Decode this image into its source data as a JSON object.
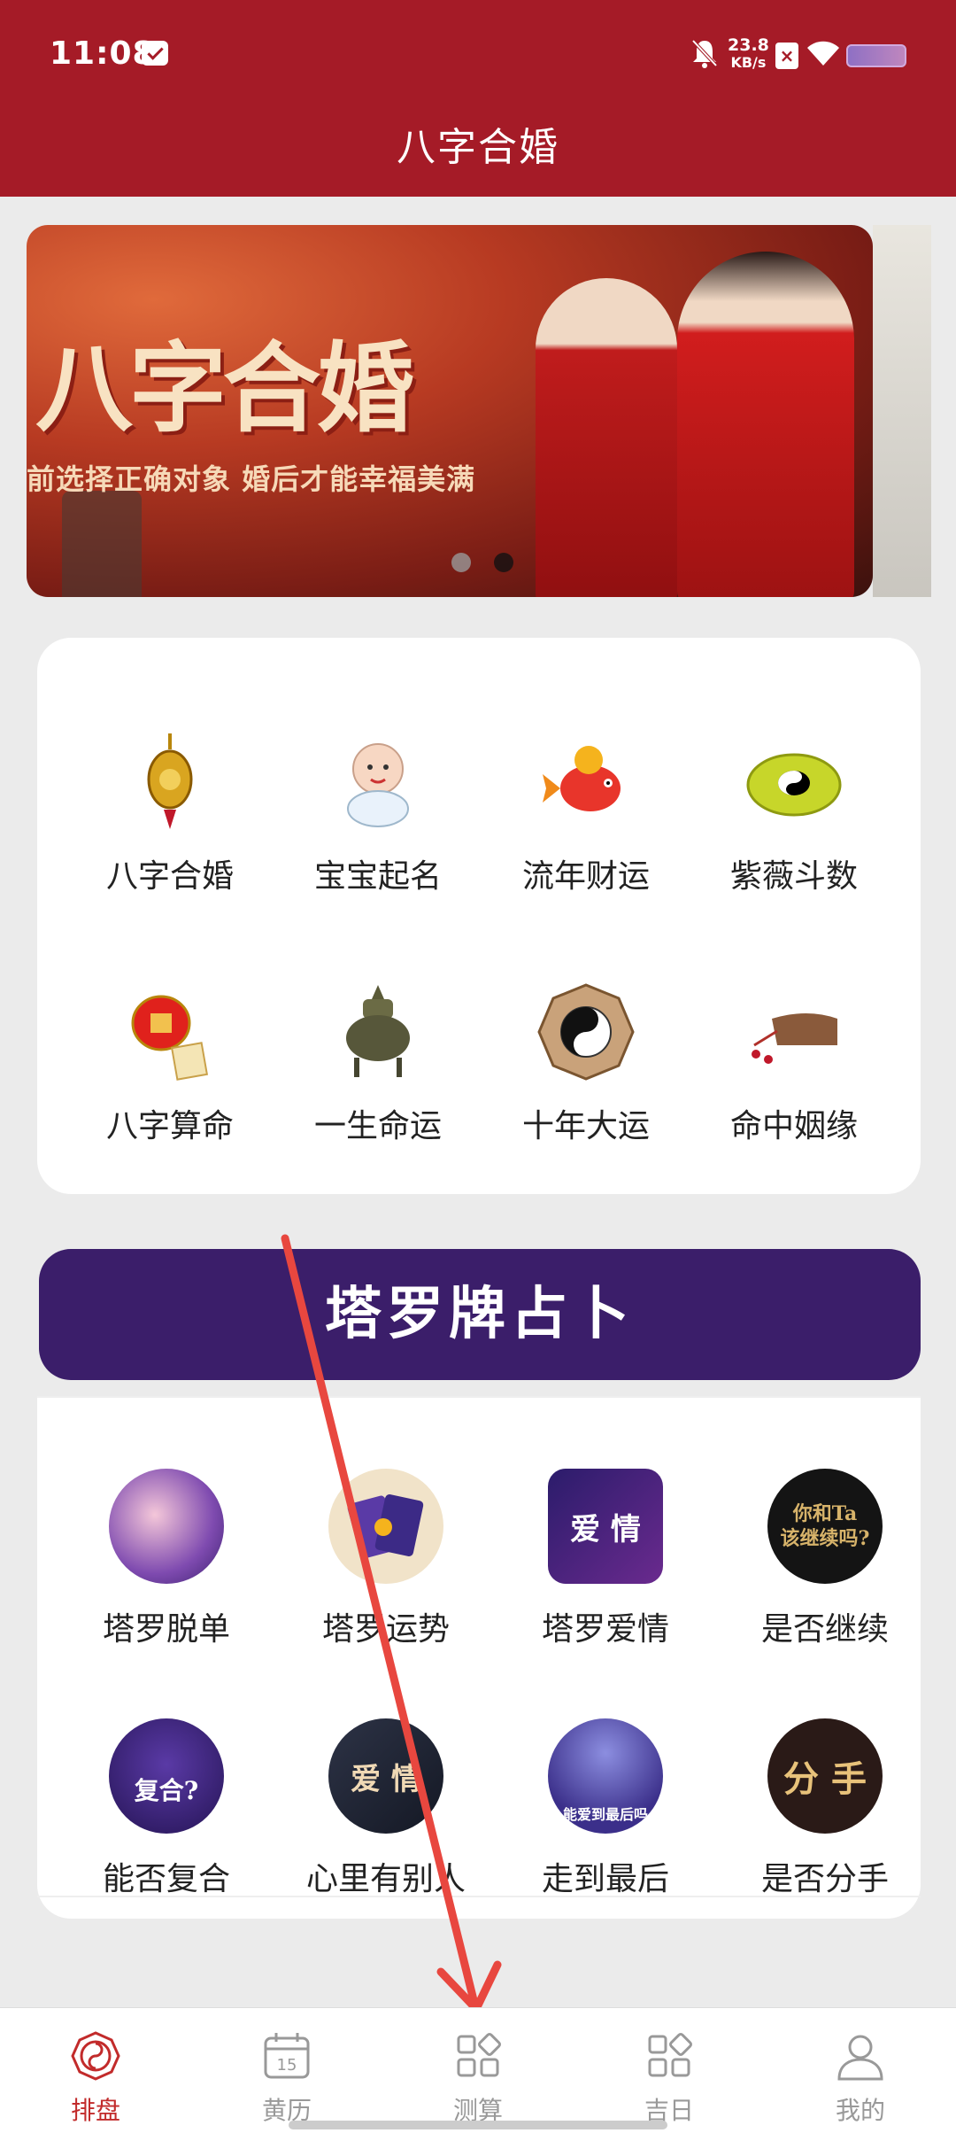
{
  "status_bar": {
    "time": "11:08",
    "net_speed_value": "23.8",
    "net_speed_unit": "KB/s",
    "sim_badge": "×"
  },
  "header": {
    "title": "八字合婚"
  },
  "banner": {
    "title": "八字合婚",
    "subtitle": "前选择正确对象 婚后才能幸福美满",
    "page_count": 2,
    "active_page": 2
  },
  "services": [
    {
      "label": "八字合婚",
      "icon": "gong-ornament-icon"
    },
    {
      "label": "宝宝起名",
      "icon": "baby-icon"
    },
    {
      "label": "流年财运",
      "icon": "lucky-fish-icon"
    },
    {
      "label": "紫薇斗数",
      "icon": "bagua-plate-icon"
    },
    {
      "label": "八字算命",
      "icon": "red-lantern-icon"
    },
    {
      "label": "一生命运",
      "icon": "incense-burner-icon"
    },
    {
      "label": "十年大运",
      "icon": "yin-yang-icon"
    },
    {
      "label": "命中姻缘",
      "icon": "comb-icon"
    }
  ],
  "tarot": {
    "title": "塔罗牌占卜",
    "items": [
      {
        "label": "塔罗脱单",
        "icon": "moon-woman-icon"
      },
      {
        "label": "塔罗运势",
        "icon": "tarot-cards-icon"
      },
      {
        "label": "塔罗爱情",
        "icon": "love-cards-icon",
        "overlay_text": "爱 情"
      },
      {
        "label": "是否继续",
        "icon": "continue-icon",
        "overlay_text": "你和Ta\n该继续吗?"
      },
      {
        "label": "能否复合",
        "icon": "reunion-icon",
        "overlay_text": "复合?"
      },
      {
        "label": "心里有别人",
        "icon": "someone-else-icon",
        "overlay_text": "爱 情"
      },
      {
        "label": "走到最后",
        "icon": "couple-icon",
        "overlay_text": "能爱到最后吗"
      },
      {
        "label": "是否分手",
        "icon": "breakup-icon",
        "overlay_text": "分 手"
      }
    ]
  },
  "bottom_nav": [
    {
      "label": "排盘",
      "icon": "paipan-icon",
      "active": true
    },
    {
      "label": "黄历",
      "icon": "calendar-icon",
      "calendar_day": "15"
    },
    {
      "label": "测算",
      "icon": "grid-icon"
    },
    {
      "label": "吉日",
      "icon": "grid-icon"
    },
    {
      "label": "我的",
      "icon": "user-icon"
    }
  ],
  "colors": {
    "header_bg": "#a51b27",
    "tarot_banner_bg": "#3b1e6a",
    "active_tab": "#c22b2b",
    "annotation_arrow": "#e8473f"
  }
}
